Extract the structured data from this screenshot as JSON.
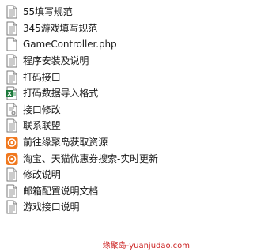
{
  "files": [
    {
      "name": "55填写规范",
      "icon": "text-file-icon"
    },
    {
      "name": "345游戏填写规范",
      "icon": "text-file-icon"
    },
    {
      "name": "GameController.php",
      "icon": "blank-file-icon"
    },
    {
      "name": "程序安装及说明",
      "icon": "text-file-icon"
    },
    {
      "name": "打码接口",
      "icon": "text-file-icon"
    },
    {
      "name": "打码数据导入格式",
      "icon": "spreadsheet-file-icon"
    },
    {
      "name": "接口修改",
      "icon": "ini-file-icon"
    },
    {
      "name": "联系联盟",
      "icon": "text-file-icon"
    },
    {
      "name": "前往缘聚岛获取资源",
      "icon": "web-shortcut-icon"
    },
    {
      "name": "淘宝、天猫优惠券搜索-实时更新",
      "icon": "web-shortcut-icon"
    },
    {
      "name": "修改说明",
      "icon": "text-file-icon"
    },
    {
      "name": "邮箱配置说明文档",
      "icon": "text-file-icon"
    },
    {
      "name": "游戏接口说明",
      "icon": "text-file-icon"
    }
  ],
  "watermark": "缘聚岛-yuanjudao.com",
  "colors": {
    "watermark": "#cc2222",
    "shortcut": "#f0781e",
    "spreadsheet": "#1e7a3c"
  }
}
